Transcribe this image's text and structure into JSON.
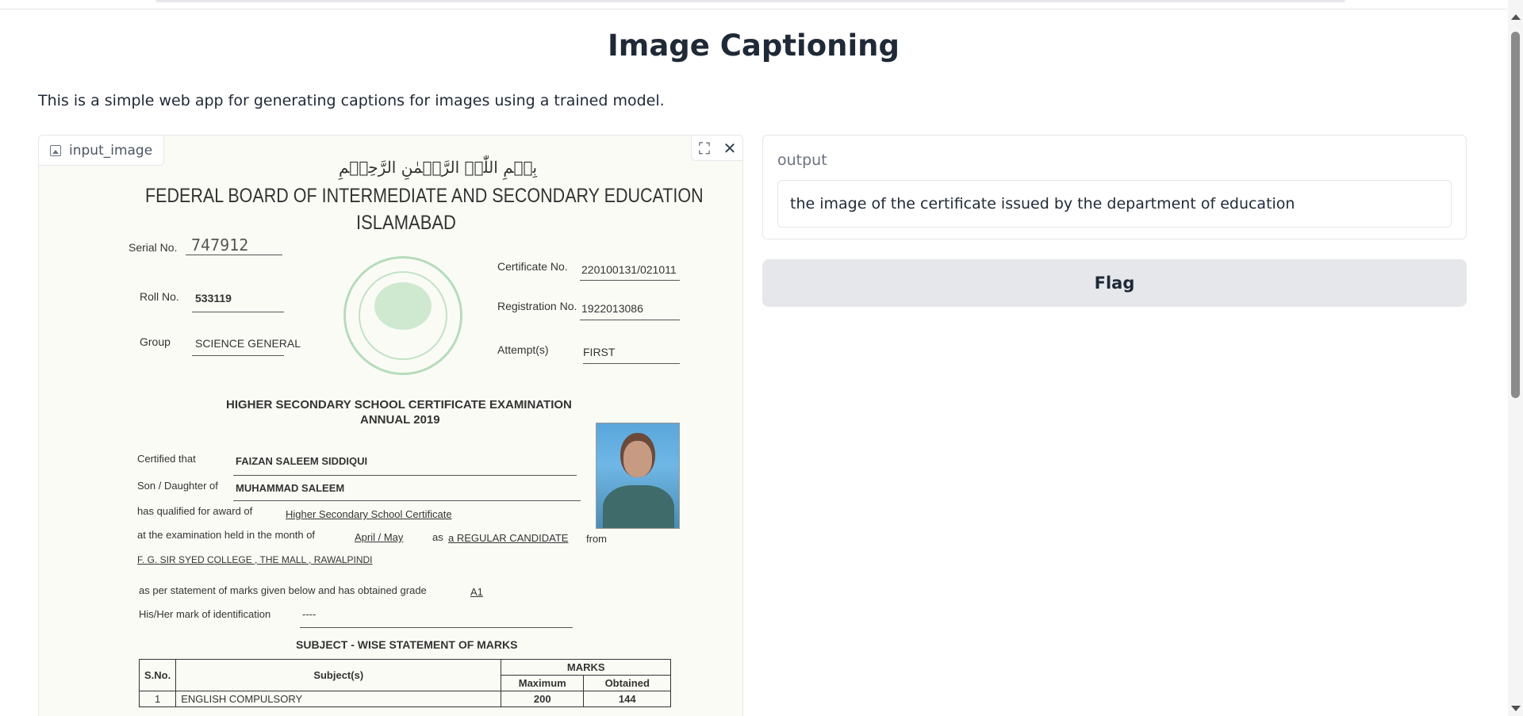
{
  "app": {
    "title": "Image Captioning",
    "description": "This is a simple web app for generating captions for images using a trained model."
  },
  "input_image": {
    "label": "input_image",
    "tools": {
      "fullscreen": "⛶",
      "close": "✕"
    },
    "certificate": {
      "basmala": "بِسۡمِ اللّٰہِ الرَّحۡمٰنِ الرَّحِیۡمِ",
      "board_name": "FEDERAL BOARD OF INTERMEDIATE AND SECONDARY EDUCATION",
      "city": "ISLAMABAD",
      "serial_label": "Serial No.",
      "serial_value": "747912",
      "roll_label": "Roll No.",
      "roll_value": "533119",
      "group_label": "Group",
      "group_value": "SCIENCE GENERAL",
      "certificate_no_label": "Certificate No.",
      "certificate_no_value": "220100131/021011",
      "registration_label": "Registration No.",
      "registration_value": "1922013086",
      "attempt_label": "Attempt(s)",
      "attempt_value": "FIRST",
      "exam_title": "HIGHER SECONDARY SCHOOL CERTIFICATE EXAMINATION",
      "exam_session": "ANNUAL 2019",
      "certified_label": "Certified that",
      "certified_name": "FAIZAN SALEEM SIDDIQUI",
      "parent_label": "Son / Daughter of",
      "parent_name": "MUHAMMAD SALEEM",
      "award_label": "has qualified for award of",
      "award_value": "Higher Secondary School Certificate",
      "exam_month_label": "at the examination held in the month of",
      "exam_month_value": "April / May",
      "as_label": "as",
      "candidate_type": "a REGULAR CANDIDATE",
      "from_label": "from",
      "institution": "F. G. SIR SYED COLLEGE , THE MALL , RAWALPINDI",
      "grade_label": "as per statement of marks given below and has obtained grade",
      "grade_value": "A1",
      "identification_label": "His/Her mark of identification",
      "identification_value": "----",
      "statement_title": "SUBJECT - WISE STATEMENT OF MARKS",
      "table": {
        "sno_header": "S.No.",
        "subject_header": "Subject(s)",
        "marks_header": "MARKS",
        "maximum_header": "Maximum",
        "obtained_header": "Obtained",
        "rows": [
          {
            "sno": "1",
            "subject": "ENGLISH COMPULSORY",
            "maximum": "200",
            "obtained": "144"
          }
        ]
      }
    }
  },
  "output": {
    "label": "output",
    "value": "the image of the certificate issued by the department of education"
  },
  "flag_button": {
    "label": "Flag"
  }
}
